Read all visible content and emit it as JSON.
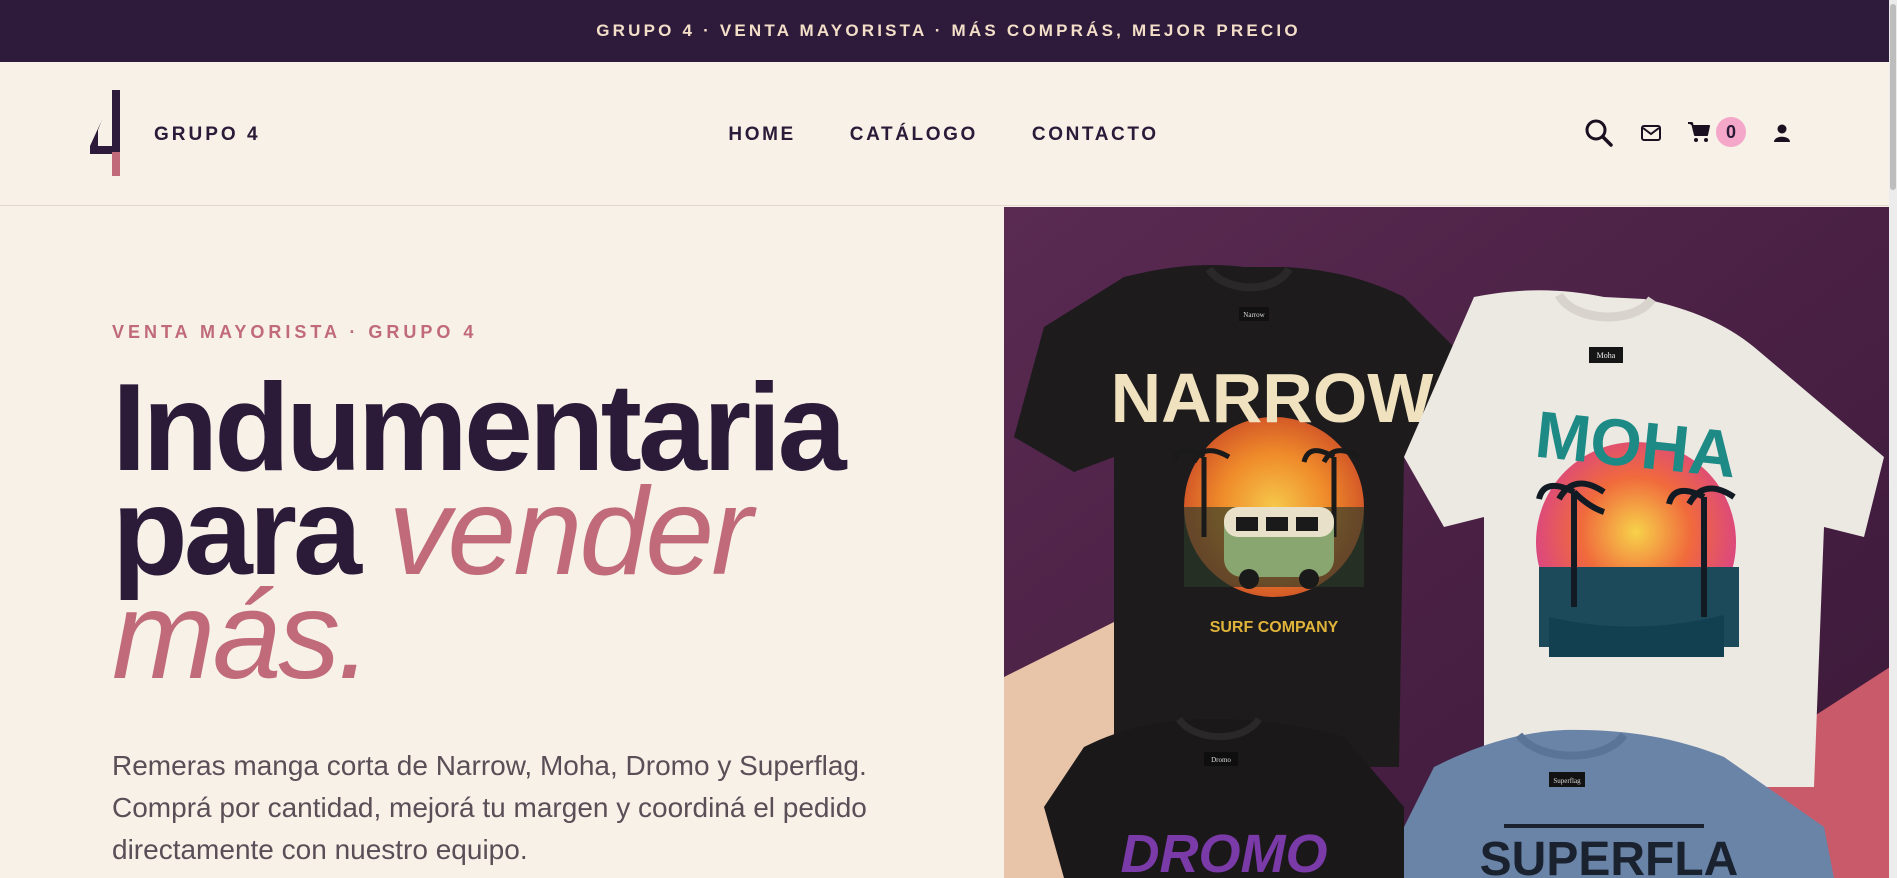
{
  "announcement": "GRUPO 4 · VENTA MAYORISTA · MÁS COMPRÁS, MEJOR PRECIO",
  "header": {
    "brand": "GRUPO 4",
    "logo_text": "GRUPO",
    "nav": [
      "HOME",
      "CATÁLOGO",
      "CONTACTO"
    ],
    "cart_count": "0",
    "icons": [
      "search-icon",
      "mail-icon",
      "cart-icon",
      "user-icon"
    ]
  },
  "hero": {
    "eyebrow": "VENTA MAYORISTA · GRUPO 4",
    "headline_line1": "Indumentaria",
    "headline_line2": "para",
    "headline_accent1": "vender",
    "headline_accent2": "más.",
    "description": "Remeras manga corta de Narrow, Moha, Dromo y Superflag. Comprá por cantidad, mejorá tu margen y coordiná el pedido directamente con nuestro equipo.",
    "image_labels": {
      "shirt1_title": "NARROW",
      "shirt1_sub": "SURF COMPANY",
      "shirt1_tag": "Narrow",
      "shirt2_title": "MOHA",
      "shirt2_tag": "Moha",
      "shirt3_title": "DROMO",
      "shirt3_tag": "Dromo",
      "shirt4_title": "SUPERFLA",
      "shirt4_tag": "Superflag"
    }
  },
  "colors": {
    "dark_plum": "#2e1a3a",
    "cream": "#f7f1e8",
    "rose": "#c06a7a",
    "badge_pink": "#f4a7c8"
  }
}
